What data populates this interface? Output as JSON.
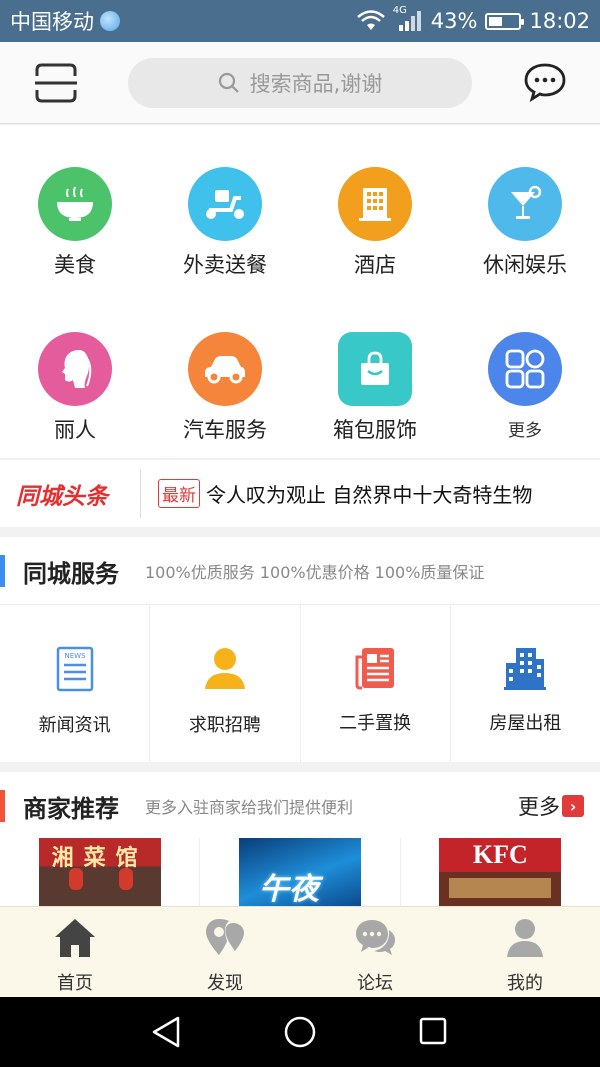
{
  "status_bar": {
    "carrier": "中国移动",
    "network": "4G",
    "battery_percent_label": "43%",
    "battery_level": 0.43,
    "time": "18:02"
  },
  "header": {
    "search_placeholder": "搜索商品,谢谢"
  },
  "categories": [
    {
      "label": "美食",
      "icon": "food-bowl-icon",
      "color": "#4cc36b"
    },
    {
      "label": "外卖送餐",
      "icon": "scooter-icon",
      "color": "#3fc1ec"
    },
    {
      "label": "酒店",
      "icon": "hotel-building-icon",
      "color": "#f29f1d"
    },
    {
      "label": "休闲娱乐",
      "icon": "cocktail-icon",
      "color": "#4fb9ec"
    },
    {
      "label": "丽人",
      "icon": "woman-profile-icon",
      "color": "#e45c9c"
    },
    {
      "label": "汽车服务",
      "icon": "car-icon",
      "color": "#f5853a"
    },
    {
      "label": "箱包服饰",
      "icon": "shopping-bag-icon",
      "color": "#38c8c8"
    },
    {
      "label": "更多",
      "icon": "grid-more-icon",
      "color": "#4d86ea"
    }
  ],
  "headline": {
    "brand": "同城头条",
    "tag": "最新",
    "text": "令人叹为观止 自然界中十大奇特生物"
  },
  "city_services": {
    "title": "同城服务",
    "subtitle": "100%优质服务 100%优惠价格 100%质量保证",
    "accent": "#3a8ef0",
    "items": [
      {
        "label": "新闻资讯",
        "icon": "news-icon",
        "icon_text": "NEWS"
      },
      {
        "label": "求职招聘",
        "icon": "job-seeker-icon"
      },
      {
        "label": "二手置换",
        "icon": "newspaper-exchange-icon"
      },
      {
        "label": "房屋出租",
        "icon": "apartment-building-icon"
      }
    ]
  },
  "merchants": {
    "title": "商家推荐",
    "subtitle": "更多入驻商家给我们提供便利",
    "more_label": "更多",
    "accent": "#f0553a",
    "items": [
      {
        "image_text": "湘菜馆"
      },
      {
        "image_text": "午夜"
      },
      {
        "image_text": "KFC"
      }
    ]
  },
  "tabbar": {
    "tabs": [
      {
        "label": "首页",
        "icon": "home-icon",
        "active": true
      },
      {
        "label": "发现",
        "icon": "location-discover-icon",
        "active": false
      },
      {
        "label": "论坛",
        "icon": "chat-bubbles-icon",
        "active": false
      },
      {
        "label": "我的",
        "icon": "user-icon",
        "active": false
      }
    ]
  }
}
